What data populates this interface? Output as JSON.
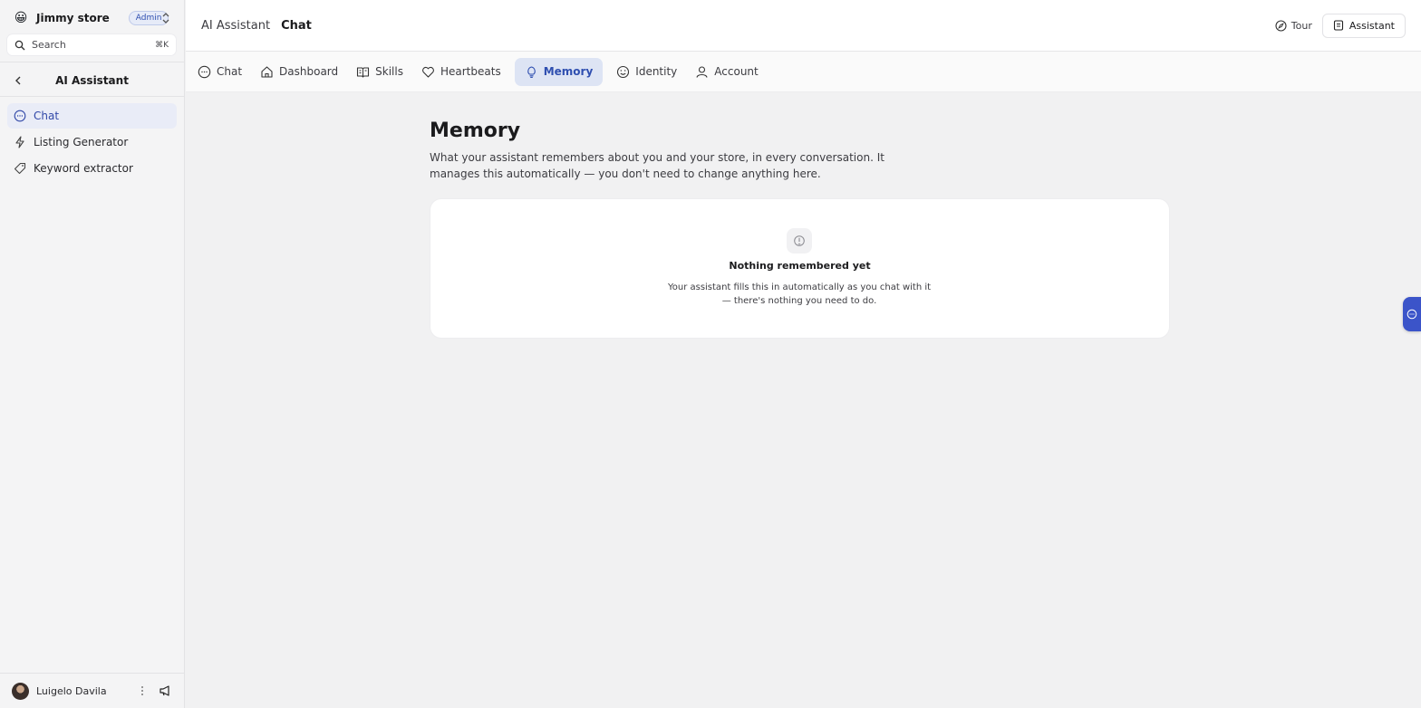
{
  "sidebar": {
    "store": {
      "emoji": "😀",
      "name": "Jimmy store",
      "role_badge": "Admin"
    },
    "search": {
      "label": "Search",
      "shortcut": "⌘K"
    },
    "section": {
      "title": "AI Assistant"
    },
    "items": [
      {
        "label": "Chat",
        "icon": "chat-bubble-icon",
        "active": true
      },
      {
        "label": "Listing Generator",
        "icon": "lightning-icon",
        "active": false
      },
      {
        "label": "Keyword extractor",
        "icon": "tag-icon",
        "active": false
      }
    ],
    "user": {
      "name": "Luigelo Davila"
    }
  },
  "topbar": {
    "breadcrumb_parent": "AI Assistant",
    "breadcrumb_current": "Chat",
    "tour_label": "Tour",
    "assistant_label": "Assistant"
  },
  "tabs": [
    {
      "label": "Chat",
      "icon": "chat-bubble-icon",
      "active": false
    },
    {
      "label": "Dashboard",
      "icon": "home-icon",
      "active": false
    },
    {
      "label": "Skills",
      "icon": "book-open-icon",
      "active": false
    },
    {
      "label": "Heartbeats",
      "icon": "heart-icon",
      "active": false
    },
    {
      "label": "Memory",
      "icon": "lightbulb-icon",
      "active": true
    },
    {
      "label": "Identity",
      "icon": "smile-icon",
      "active": false
    },
    {
      "label": "Account",
      "icon": "user-icon",
      "active": false
    }
  ],
  "main": {
    "title": "Memory",
    "description": "What your assistant remembers about you and your store, in every conversation. It manages this automatically — you don't need to change anything here.",
    "empty_state": {
      "title": "Nothing remembered yet",
      "description": "Your assistant fills this in automatically as you chat with it — there's nothing you need to do."
    }
  },
  "colors": {
    "accent": "#2f4fb0",
    "active_tab_bg": "#dde4f4",
    "active_nav_bg": "#e9ecf7",
    "side_tab": "#3b54c9"
  }
}
